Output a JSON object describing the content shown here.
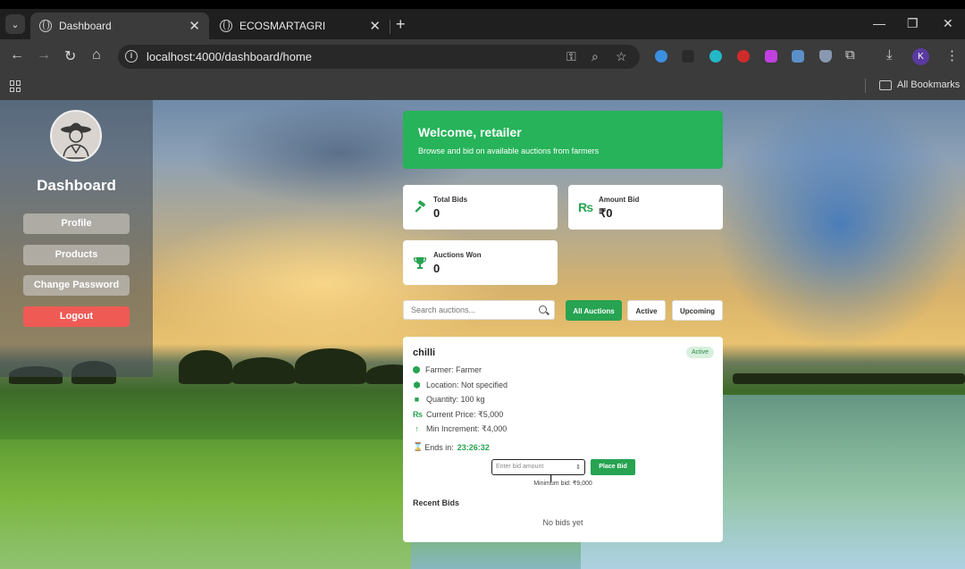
{
  "browser": {
    "tabs": [
      {
        "title": "Dashboard",
        "active": true
      },
      {
        "title": "ECOSMARTAGRI",
        "active": false
      }
    ],
    "url": "localhost:4000/dashboard/home",
    "bookmarks_label": "All Bookmarks",
    "profile_initial": "K"
  },
  "sidebar": {
    "title": "Dashboard",
    "items": [
      {
        "label": "Profile"
      },
      {
        "label": "Products"
      },
      {
        "label": "Change Password"
      },
      {
        "label": "Logout"
      }
    ]
  },
  "welcome": {
    "heading": "Welcome, retailer",
    "subtext": "Browse and bid on available auctions from farmers"
  },
  "stats": [
    {
      "label": "Total Bids",
      "value": "0",
      "icon": "gavel-icon"
    },
    {
      "label": "Amount Bid",
      "value": "₹0",
      "icon": "rupee-icon"
    },
    {
      "label": "Auctions Won",
      "value": "0",
      "icon": "trophy-icon"
    }
  ],
  "search": {
    "placeholder": "Search auctions..."
  },
  "filters": [
    {
      "label": "All Auctions",
      "selected": true
    },
    {
      "label": "Active",
      "selected": false
    },
    {
      "label": "Upcoming",
      "selected": false
    }
  ],
  "auction": {
    "name": "chilli",
    "status": "Active",
    "farmer": "Farmer: Farmer",
    "location": "Location: Not specified",
    "quantity": "Quantity: 100 kg",
    "current_price": "Current Price: ₹5,000",
    "min_increment": "Min Increment: ₹4,000",
    "ends_label": "Ends in:",
    "ends_timer": "23:26:32",
    "bid_placeholder": "Enter bid amount",
    "place_bid_label": "Place Bid",
    "min_bid": "Minimum bid: ₹9,000",
    "recent_bids_title": "Recent Bids",
    "no_bids": "No bids yet"
  },
  "colors": {
    "accent": "#27a352",
    "logout": "#f05a55",
    "welcome_bg": "#26b35a"
  }
}
